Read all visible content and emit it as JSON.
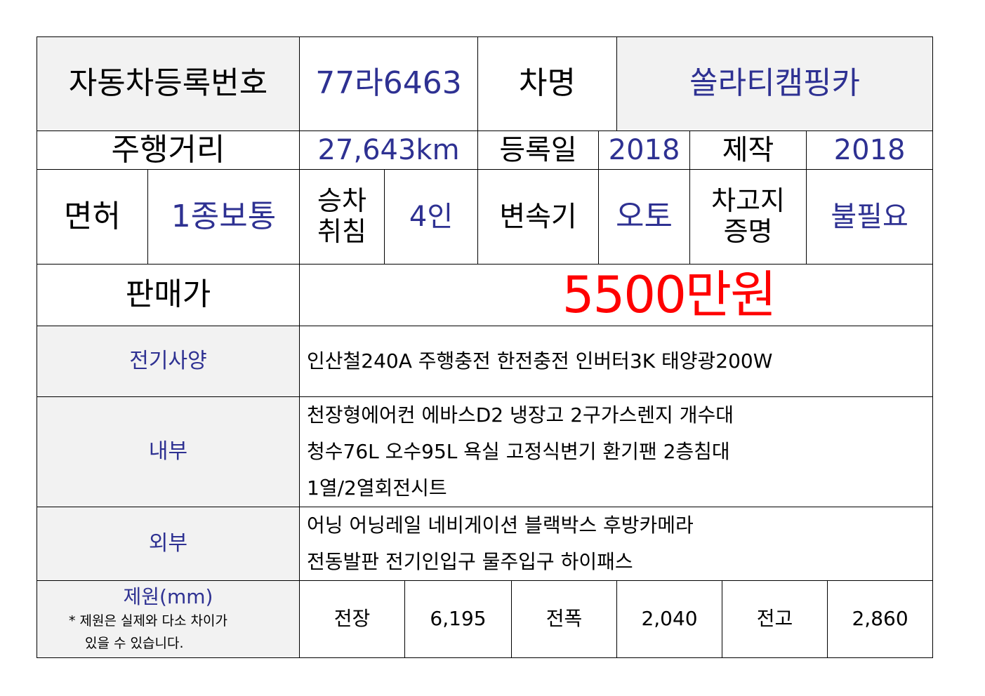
{
  "header": {
    "reg_no_label": "자동차등록번호",
    "reg_no": "77라6463",
    "model_label": "차명",
    "model": "쏠라티캠핑카"
  },
  "row2": {
    "mileage_label": "주행거리",
    "mileage": "27,643km",
    "reg_date_label": "등록일",
    "reg_date": "2018",
    "made_label": "제작",
    "made": "2018"
  },
  "row3": {
    "license_label": "면허",
    "license": "1종보통",
    "seats_label": [
      "승차",
      "취침"
    ],
    "seats": "4인",
    "transmission_label": "변속기",
    "transmission": "오토",
    "garage_label": [
      "차고지",
      "증명"
    ],
    "garage": "불필요"
  },
  "price": {
    "label": "판매가",
    "value": "5500만원"
  },
  "electric": {
    "label": "전기사양",
    "lines": [
      "인산철240A 주행충전 한전충전 인버터3K 태양광200W"
    ]
  },
  "interior": {
    "label": "내부",
    "lines": [
      "천장형에어컨 에바스D2 냉장고 2구가스렌지 개수대",
      "청수76L 오수95L 욕실 고정식변기 환기팬 2층침대",
      "1열/2열회전시트"
    ]
  },
  "exterior": {
    "label": "외부",
    "lines": [
      "어닝 어닝레일 네비게이션 블랙박스 후방카메라",
      "전동발판 전기인입구 물주입구 하이패스"
    ]
  },
  "dimensions": {
    "label": "제원(mm)",
    "note": [
      "* 제원은 실제와 다소 차이가",
      "있을 수 있습니다."
    ],
    "length_label": "전장",
    "length": "6,195",
    "width_label": "전폭",
    "width": "2,040",
    "height_label": "전고",
    "height": "2,860"
  },
  "colors": {
    "label_bg": "#f2f2f2",
    "value_text": "#2e3192",
    "price_text": "#ff0000",
    "border": "#000000"
  }
}
